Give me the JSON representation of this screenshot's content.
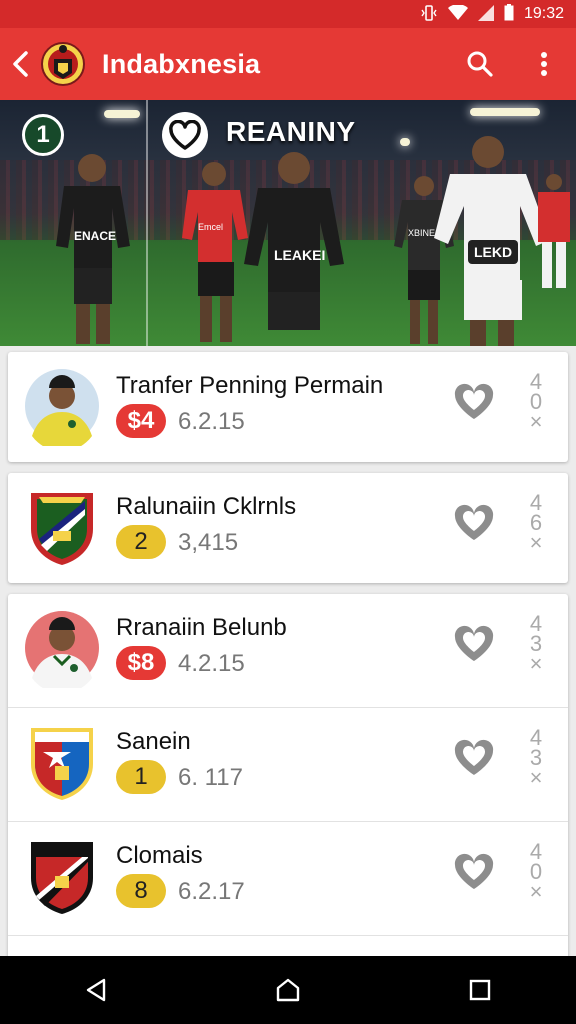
{
  "status_bar": {
    "time": "19:32",
    "colors": {
      "bar": "#d42a2a"
    }
  },
  "app_bar": {
    "title": "Indabxnesia",
    "back_icon": "arrow-back-icon",
    "search_icon": "search-icon",
    "menu_icon": "more-vertical-icon"
  },
  "hero": {
    "badge": "1",
    "title": "REANINY",
    "heart_icon": "heart-icon",
    "jersey_texts": [
      "ENACE",
      "Emcel",
      "LEAKEI",
      "XBINE",
      "LEKD"
    ]
  },
  "items": [
    {
      "name": "Tranfer Penning Permain",
      "badge": "$4",
      "badge_style": "red",
      "value": "6.2.15",
      "avatar": "player-photo",
      "side": [
        "4",
        "0",
        "×"
      ]
    },
    {
      "name": "Ralunaiin Cklrnls",
      "badge": "2",
      "badge_style": "yellow",
      "value": "3,415",
      "avatar": "club-crest",
      "side": [
        "4",
        "6",
        "×"
      ]
    },
    {
      "name": "Rranaiin Belunb",
      "badge": "$8",
      "badge_style": "red",
      "value": "4.2.15",
      "avatar": "player-photo",
      "side": [
        "4",
        "3",
        "×"
      ]
    },
    {
      "name": "Sanein",
      "badge": "1",
      "badge_style": "yellow",
      "value": "6. 117",
      "avatar": "club-crest",
      "side": [
        "4",
        "3",
        "×"
      ]
    },
    {
      "name": "Clomais",
      "badge": "8",
      "badge_style": "yellow",
      "value": "6.2.17",
      "avatar": "club-crest",
      "side": [
        "4",
        "0",
        "×"
      ]
    }
  ],
  "colors": {
    "accent": "#e53935",
    "yellow_badge": "#e8c22d"
  }
}
